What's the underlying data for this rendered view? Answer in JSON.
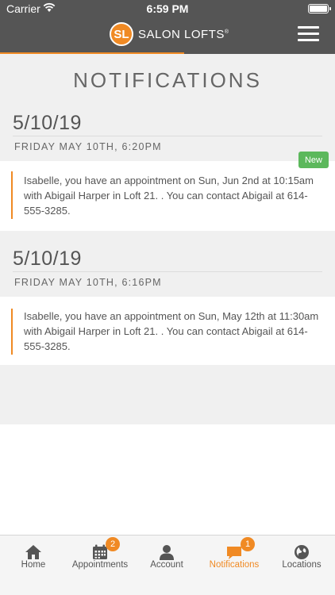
{
  "status_bar": {
    "carrier": "Carrier",
    "time": "6:59 PM"
  },
  "header": {
    "logo_initials": "SL",
    "brand_name": "SALON LOFTS",
    "brand_mark": "®",
    "menu_icon": "hamburger-menu-icon"
  },
  "load_progress": {
    "fraction": 0.55
  },
  "page": {
    "title": "NOTIFICATIONS"
  },
  "notifications": [
    {
      "date": "5/10/19",
      "datetime": "FRIDAY MAY 10TH, 6:20PM",
      "badge": "New",
      "message": "Isabelle, you have an appointment on Sun, Jun 2nd at 10:15am with Abigail Harper in Loft 21. . You can contact Abigail at 614-555-3285."
    },
    {
      "date": "5/10/19",
      "datetime": "FRIDAY MAY 10TH, 6:16PM",
      "badge": "",
      "message": "Isabelle, you have an appointment on Sun, May 12th at 11:30am with Abigail Harper in Loft 21. . You can contact Abigail at 614-555-3285."
    }
  ],
  "tabbar": {
    "tabs": [
      {
        "label": "Home",
        "icon": "home-icon",
        "badge": ""
      },
      {
        "label": "Appointments",
        "icon": "calendar-icon",
        "badge": "2"
      },
      {
        "label": "Account",
        "icon": "person-icon",
        "badge": ""
      },
      {
        "label": "Notifications",
        "icon": "chat-bubble-icon",
        "badge": "1"
      },
      {
        "label": "Locations",
        "icon": "globe-icon",
        "badge": ""
      }
    ]
  },
  "colors": {
    "accent": "#f08a24",
    "header_bg": "#555555",
    "badge_new": "#5cb85c"
  }
}
